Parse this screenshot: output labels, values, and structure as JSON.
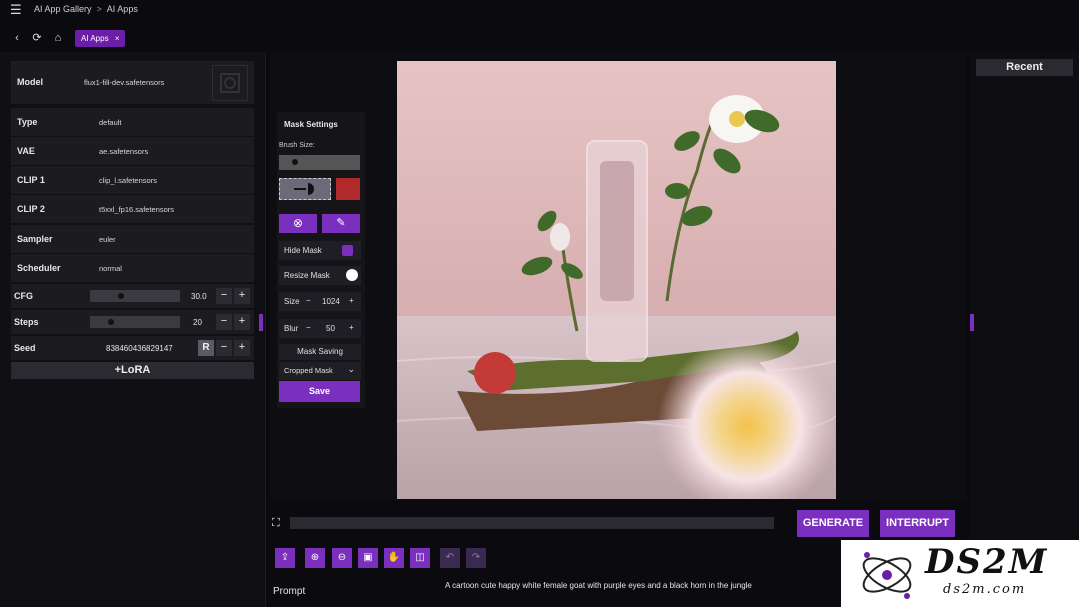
{
  "breadcrumb": {
    "home": "AI App Gallery",
    "separator": ">",
    "current": "AI Apps"
  },
  "tab": {
    "label": "AI Apps",
    "close": "×"
  },
  "nav": {
    "back_icon": "back-arrow-icon",
    "refresh_icon": "refresh-icon",
    "home_icon": "home-icon",
    "menu_icon": "hamburger-menu-icon"
  },
  "params": [
    {
      "label": "Model",
      "value": "flux1-fill-dev.safetensors"
    },
    {
      "label": "Type",
      "value": "default"
    },
    {
      "label": "VAE",
      "value": "ae.safetensors"
    },
    {
      "label": "CLIP 1",
      "value": "clip_l.safetensors"
    },
    {
      "label": "CLIP 2",
      "value": "t5xxl_fp16.safetensors"
    },
    {
      "label": "Sampler",
      "value": "euler"
    },
    {
      "label": "Scheduler",
      "value": "normal"
    }
  ],
  "sliders": {
    "cfg": {
      "label": "CFG",
      "value": "30.0",
      "fraction": 0.33
    },
    "steps": {
      "label": "Steps",
      "value": "20",
      "fraction": 0.22
    }
  },
  "seed": {
    "label": "Seed",
    "value": "838460436829147",
    "random_label": "R"
  },
  "stepper": {
    "minus": "−",
    "plus": "+"
  },
  "lora_button": "+LoRA",
  "mask": {
    "title": "Mask Settings",
    "brush_size_label": "Brush Size:",
    "brush_color": "#b02a2a",
    "hide_mask_label": "Hide Mask",
    "resize_mask_label": "Resize Mask",
    "size_label": "Size",
    "size_value": "1024",
    "blur_label": "Blur",
    "blur_value": "50",
    "mask_saving_label": "Mask Saving",
    "mask_saving_option": "Cropped Mask",
    "save_label": "Save"
  },
  "recent_label": "Recent",
  "actions": {
    "generate": "GENERATE",
    "interrupt": "INTERRUPT"
  },
  "prompt": {
    "label": "Prompt",
    "text": "A cartoon cute happy white female goat with purple eyes and a black horn in the jungle"
  },
  "watermark": {
    "brand": "DS2M",
    "domain": "ds2m.com"
  },
  "colors": {
    "accent": "#7b2fbe",
    "tab": "#6b1fa8",
    "background": "#0b0b0f",
    "panel": "#1b1b20"
  }
}
